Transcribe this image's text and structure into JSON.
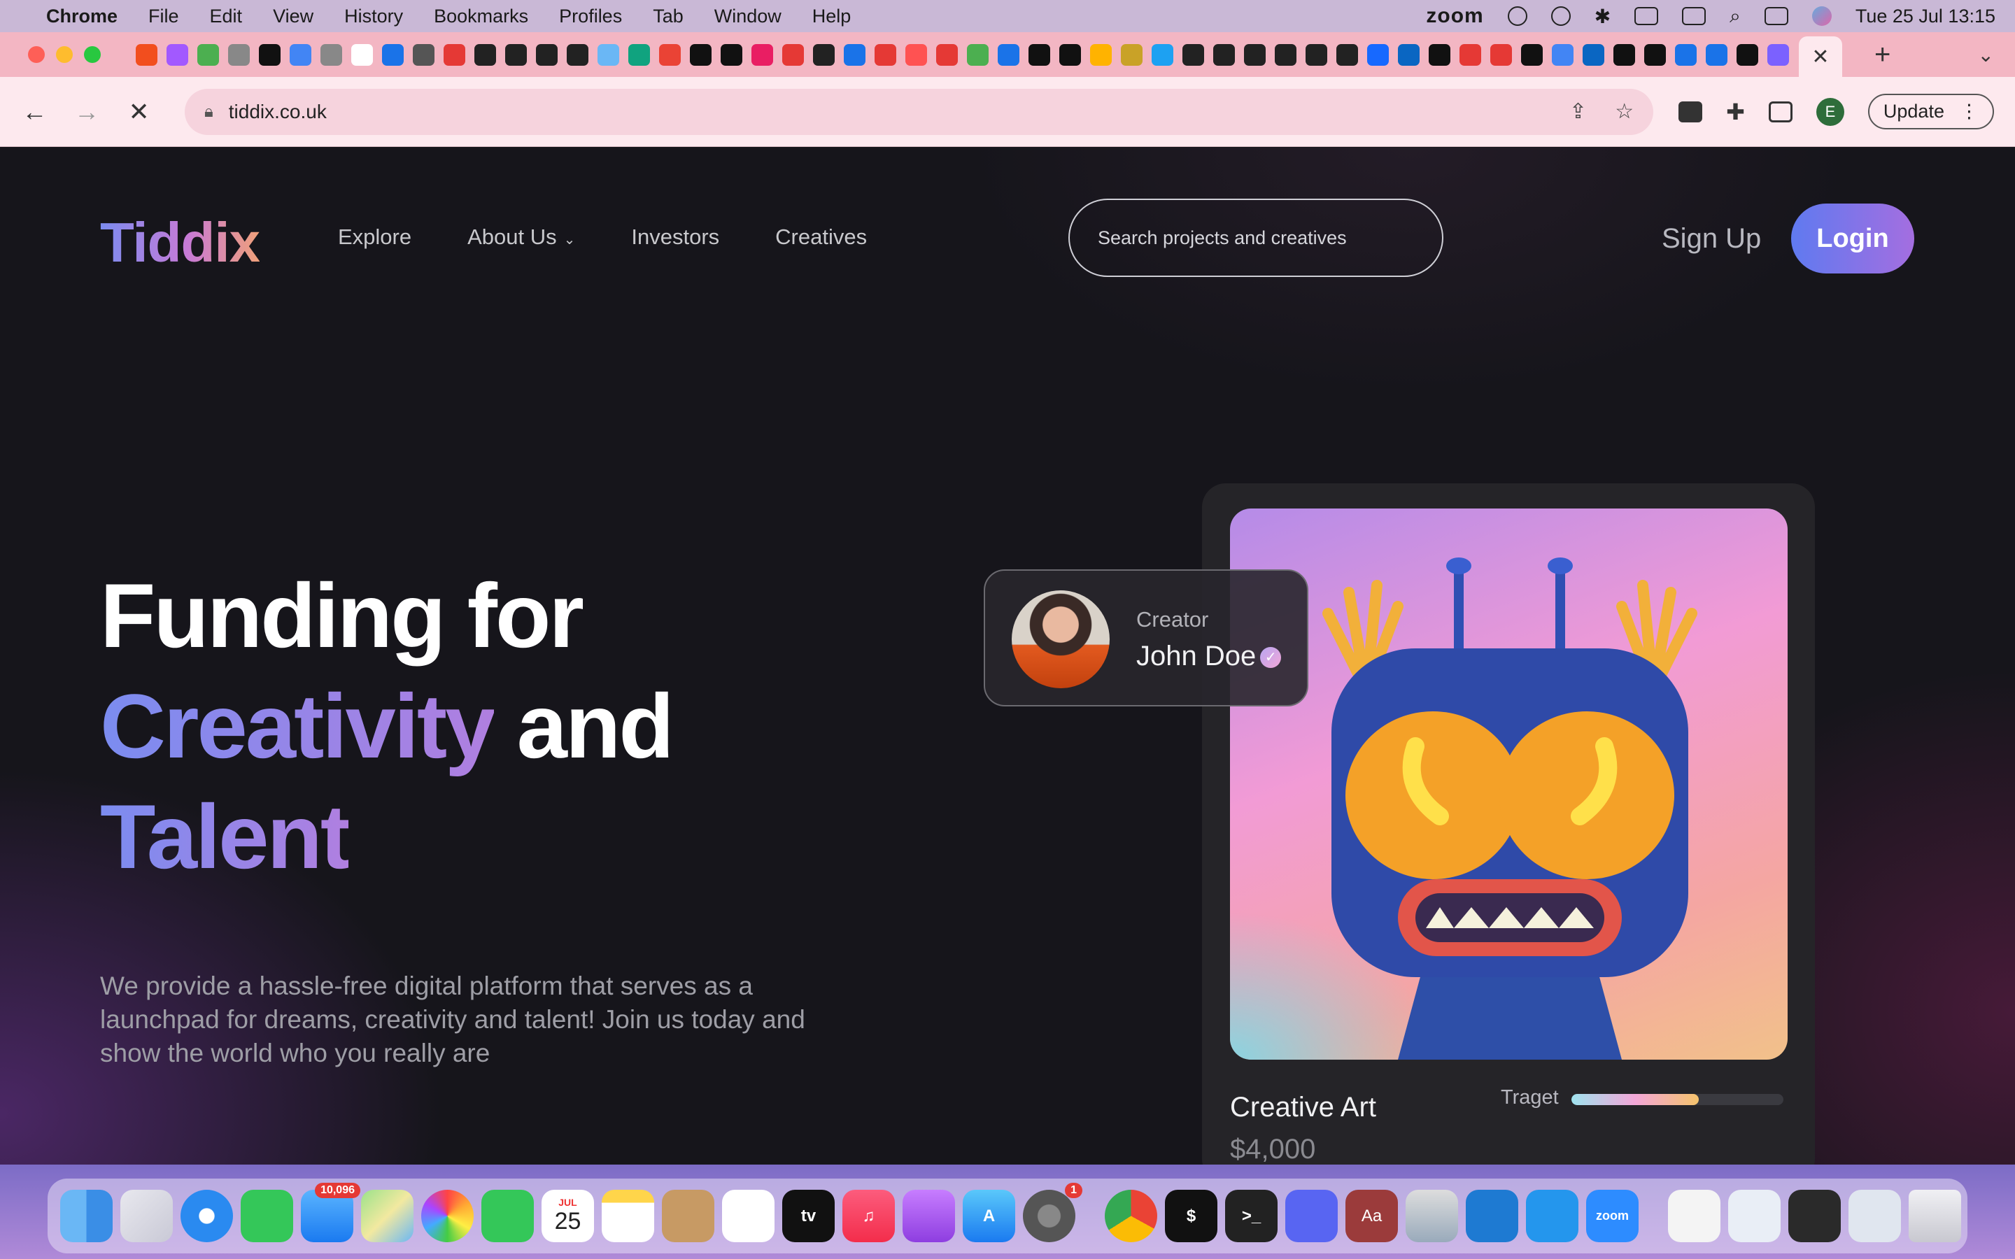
{
  "menubar": {
    "app": "Chrome",
    "items": [
      "File",
      "Edit",
      "View",
      "History",
      "Bookmarks",
      "Profiles",
      "Tab",
      "Window",
      "Help"
    ],
    "zoom": "zoom",
    "datetime": "Tue 25 Jul  13:15"
  },
  "browser": {
    "url": "tiddix.co.uk",
    "update_label": "Update",
    "profile_initial": "E",
    "active_tab_close": "✕",
    "new_tab": "+"
  },
  "site": {
    "logo": "Tiddix",
    "nav": {
      "explore": "Explore",
      "about": "About Us",
      "investors": "Investors",
      "creatives": "Creatives"
    },
    "search_placeholder": "Search projects and creatives",
    "signup": "Sign Up",
    "login": "Login",
    "hero": {
      "line1": "Funding for",
      "word_creativity": "Creativity",
      "word_and": "and",
      "word_talent": "Talent",
      "description": "We provide a hassle-free digital platform that serves as a launchpad for dreams, creativity and talent! Join us today and show the world who you really are"
    },
    "creator_card": {
      "label": "Creator",
      "name": "John Doe"
    },
    "project_card": {
      "title": "Creative Art",
      "target_label": "Traget",
      "price": "$4,000",
      "progress": 0.6
    }
  },
  "dock": {
    "mail_badge": "10,096",
    "calendar_month": "JUL",
    "calendar_day": "25",
    "settings_badge": "1",
    "tv_label": "tv",
    "zoom_label": "zoom",
    "dictionary_label": "Aa"
  }
}
